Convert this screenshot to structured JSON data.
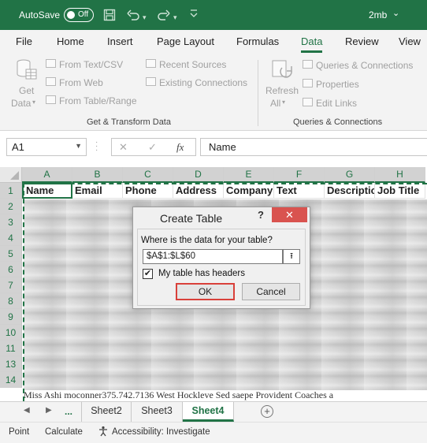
{
  "titlebar": {
    "autosave_label": "AutoSave",
    "toggle_state": "Off",
    "document_name": "2mb",
    "icons": [
      "save-icon",
      "undo-icon",
      "redo-icon"
    ]
  },
  "ribbon_tabs": [
    "File",
    "Home",
    "Insert",
    "Page Layout",
    "Formulas",
    "Data",
    "Review",
    "View"
  ],
  "active_tab": "Data",
  "ribbon": {
    "get_data": {
      "line1": "Get",
      "line2": "Data"
    },
    "from_text_csv": "From Text/CSV",
    "from_web": "From Web",
    "from_table_range": "From Table/Range",
    "recent_sources": "Recent Sources",
    "existing_connections": "Existing Connections",
    "group_get_transform": "Get & Transform Data",
    "refresh": {
      "line1": "Refresh",
      "line2": "All"
    },
    "queries_connections": "Queries & Connections",
    "properties": "Properties",
    "edit_links": "Edit Links",
    "group_queries": "Queries & Connections"
  },
  "formula_bar": {
    "name_box": "A1",
    "content": "Name"
  },
  "grid": {
    "columns": [
      "A",
      "B",
      "C",
      "D",
      "E",
      "F",
      "G",
      "H"
    ],
    "rows": [
      "1",
      "2",
      "3",
      "4",
      "5",
      "6",
      "7",
      "8",
      "9",
      "10",
      "11",
      "13",
      "14"
    ],
    "header_row": [
      "Name",
      "Email",
      "Phone",
      "Address",
      "Company",
      "Text",
      "Descriptic",
      "Job Title"
    ],
    "row14_text": "Miss Ashi moconner375.742.7136 West Hockleve Sed saepe Provident Coaches a"
  },
  "dialog": {
    "title": "Create Table",
    "help": "?",
    "close": "✕",
    "prompt": "Where is the data for your table?",
    "range": "$A$1:$L$60",
    "has_headers_label": "My table has headers",
    "has_headers_checked": true,
    "ok": "OK",
    "cancel": "Cancel"
  },
  "sheets": {
    "more": "...",
    "tabs": [
      "Sheet2",
      "Sheet3",
      "Sheet4"
    ],
    "active": "Sheet4"
  },
  "status": {
    "mode": "Point",
    "calculate": "Calculate",
    "accessibility": "Accessibility: Investigate"
  }
}
